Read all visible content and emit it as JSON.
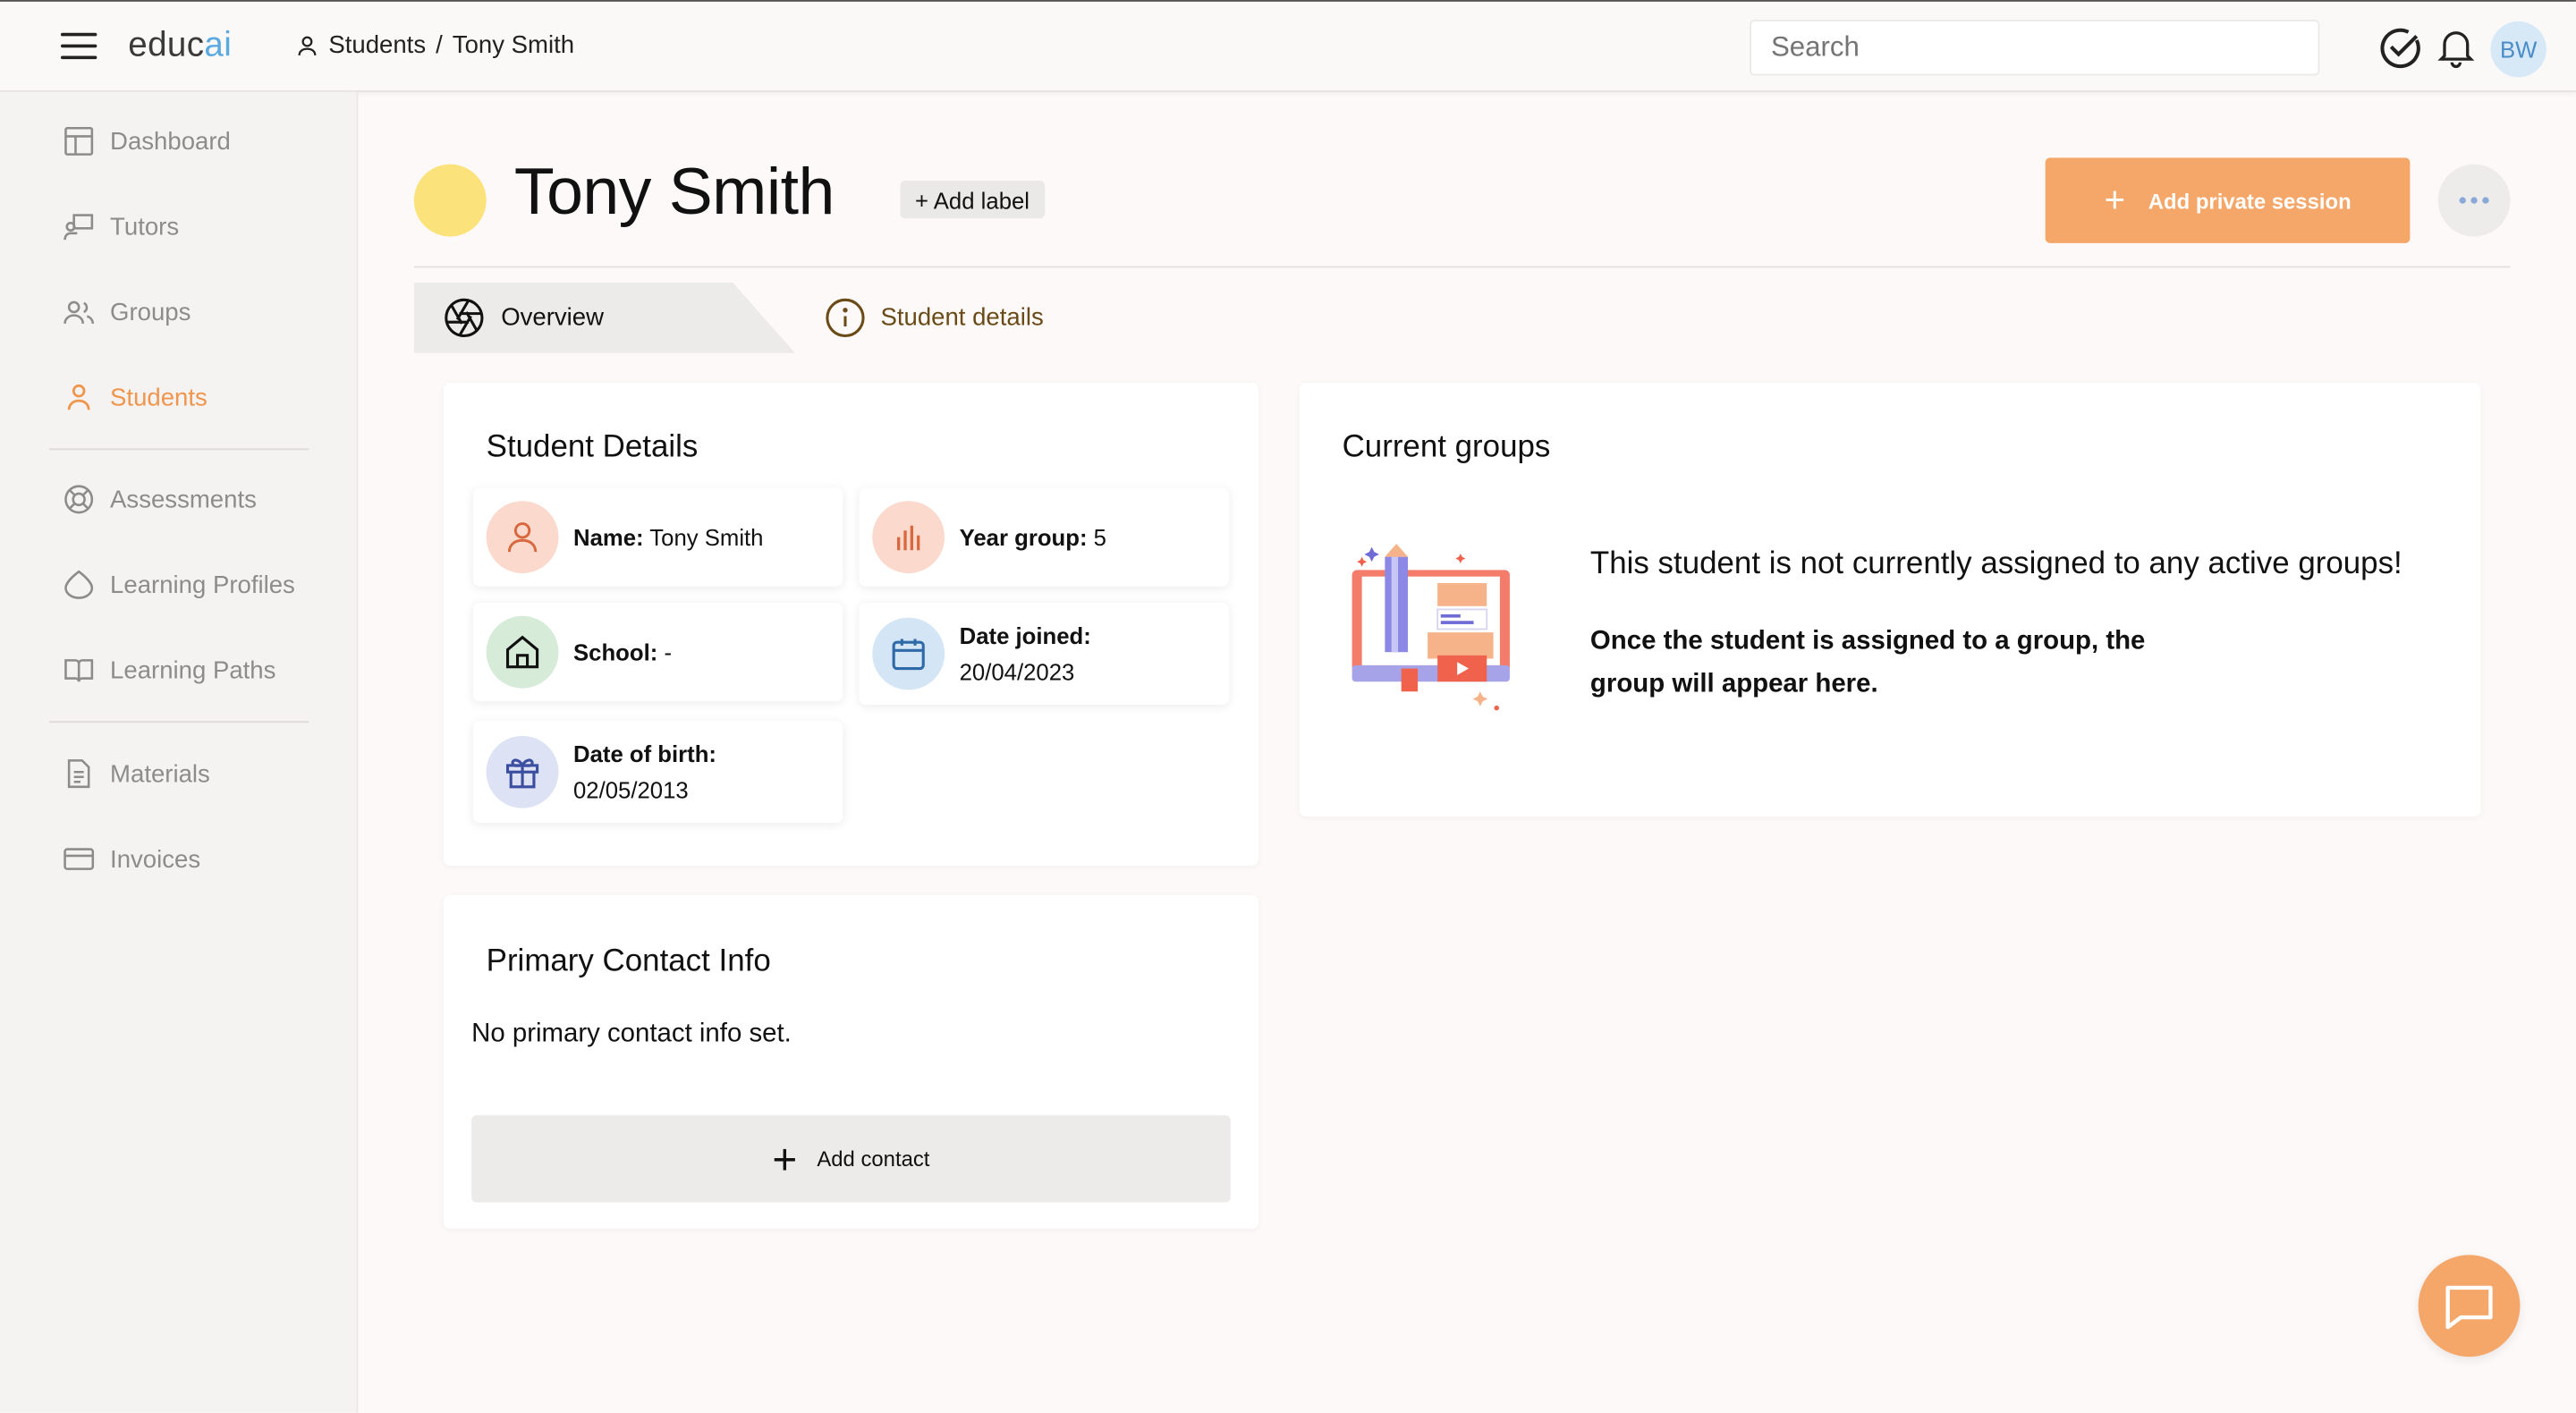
{
  "app": {
    "logo_main": "educ",
    "logo_accent": "ai"
  },
  "breadcrumb": {
    "section": "Students",
    "separator": "/",
    "current": "Tony Smith"
  },
  "search": {
    "placeholder": "Search"
  },
  "user": {
    "initials": "BW"
  },
  "sidebar": {
    "items": [
      {
        "label": "Dashboard",
        "icon": "dashboard-icon"
      },
      {
        "label": "Tutors",
        "icon": "tutor-icon"
      },
      {
        "label": "Groups",
        "icon": "groups-icon"
      },
      {
        "label": "Students",
        "icon": "student-icon",
        "active": true
      },
      {
        "label": "Assessments",
        "icon": "assessment-icon"
      },
      {
        "label": "Learning Profiles",
        "icon": "learning-profile-icon"
      },
      {
        "label": "Learning Paths",
        "icon": "book-icon"
      },
      {
        "label": "Materials",
        "icon": "document-icon"
      },
      {
        "label": "Invoices",
        "icon": "card-icon"
      }
    ]
  },
  "header": {
    "title": "Tony Smith",
    "add_label": "+ Add label",
    "add_session": "Add private session",
    "add_session_plus": "+"
  },
  "tabs": [
    {
      "label": "Overview",
      "active": true
    },
    {
      "label": "Student details",
      "active": false
    }
  ],
  "student_details": {
    "title": "Student Details",
    "name_label": "Name:",
    "name_value": "Tony Smith",
    "year_label": "Year group:",
    "year_value": "5",
    "school_label": "School:",
    "school_value": "-",
    "joined_label": "Date joined:",
    "joined_value": "20/04/2023",
    "dob_label": "Date of birth:",
    "dob_value": "02/05/2013"
  },
  "primary_contact": {
    "title": "Primary Contact Info",
    "empty_text": "No primary contact info set.",
    "add_button": "Add contact",
    "add_plus": "+"
  },
  "current_groups": {
    "title": "Current groups",
    "message_main": "This student is not currently assigned to any active groups!",
    "message_sub": "Once the student is assigned to a group, the group will appear here."
  },
  "colors": {
    "accent": "#f0954c",
    "button_orange": "#f5a76a",
    "avatar_yellow": "#fbe27a",
    "logo_blue": "#5aa9e0"
  }
}
